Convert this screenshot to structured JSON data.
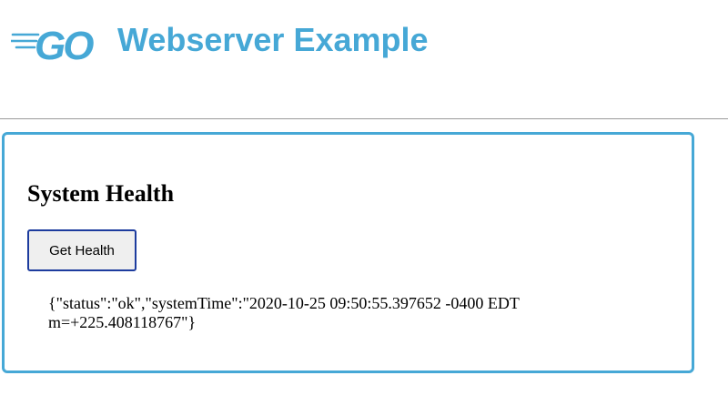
{
  "colors": {
    "accent": "#46a8d6",
    "button_border": "#1d3c9e"
  },
  "header": {
    "logo_icon": "go-gopher-logo-icon",
    "logo_text": "GO",
    "title": "Webserver Example"
  },
  "panel": {
    "title": "System Health",
    "button_label": "Get Health",
    "response_line1": "{\"status\":\"ok\",\"systemTime\":\"2020-10-25 09:50:55.397652 -0400 EDT",
    "response_line2": "m=+225.408118767\"}"
  }
}
